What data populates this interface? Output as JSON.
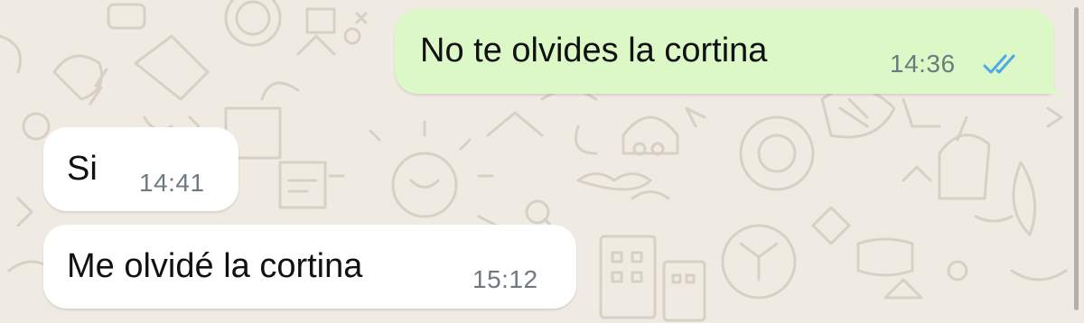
{
  "chat": {
    "messages": [
      {
        "direction": "outgoing",
        "text": "No te olvides la cortina",
        "time": "14:36",
        "status": "read",
        "status_icon": "double-check-icon"
      },
      {
        "direction": "incoming",
        "text": "Si",
        "time": "14:41"
      },
      {
        "direction": "incoming",
        "text": "Me olvidé la cortina",
        "time": "15:12"
      }
    ]
  },
  "colors": {
    "wallpaper": "#efeae2",
    "outgoing_bubble": "#dcf8c6",
    "incoming_bubble": "#ffffff",
    "read_ticks": "#4fa8e8",
    "timestamp": "#6f7a7f"
  }
}
